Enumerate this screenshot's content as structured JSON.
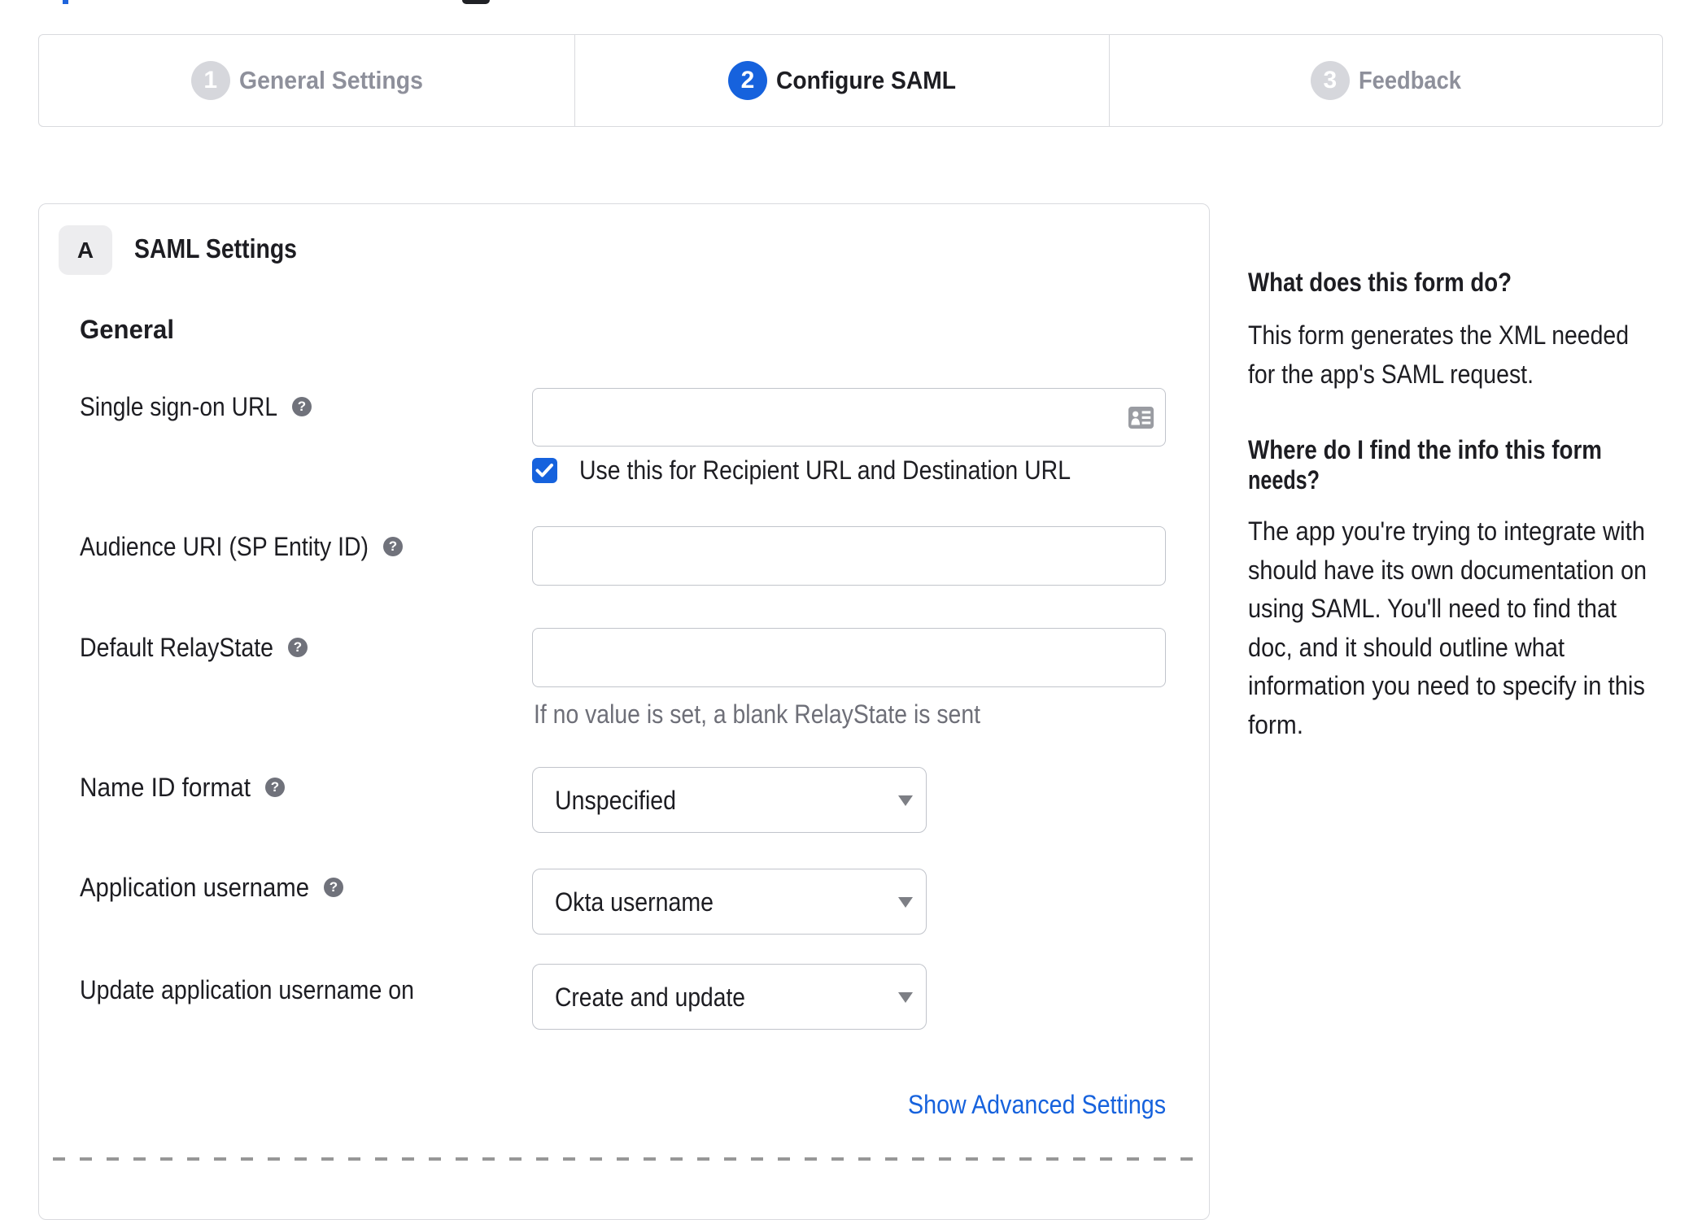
{
  "stepper": {
    "steps": [
      {
        "number": "1",
        "label": "General Settings",
        "state": "inactive"
      },
      {
        "number": "2",
        "label": "Configure SAML",
        "state": "active"
      },
      {
        "number": "3",
        "label": "Feedback",
        "state": "inactive"
      }
    ]
  },
  "panel": {
    "section_badge": "A",
    "section_title": "SAML Settings",
    "group_heading": "General",
    "show_advanced_label": "Show Advanced Settings"
  },
  "form": {
    "rows": [
      {
        "label": "Single sign-on URL",
        "has_help": true,
        "control": "input",
        "value": "",
        "checkbox_label": "Use this for Recipient URL and Destination URL",
        "checkbox_checked": true
      },
      {
        "label": "Audience URI (SP Entity ID)",
        "has_help": true,
        "control": "input",
        "value": ""
      },
      {
        "label": "Default RelayState",
        "has_help": true,
        "control": "input",
        "value": "",
        "helper": "If no value is set, a blank RelayState is sent"
      },
      {
        "label": "Name ID format",
        "has_help": true,
        "control": "select",
        "value": "Unspecified"
      },
      {
        "label": "Application username",
        "has_help": true,
        "control": "select",
        "value": "Okta username"
      },
      {
        "label": "Update application username on",
        "has_help": false,
        "control": "select",
        "value": "Create and update"
      }
    ]
  },
  "sidebar": {
    "what_heading": "What does this form do?",
    "what_body_lines": [
      "This form generates the XML needed",
      "for the app's SAML request."
    ],
    "where_heading_lines": [
      "Where do I find the info this form",
      "needs?"
    ],
    "where_body_lines": [
      "The app you're trying to integrate with",
      "should have its own documentation on",
      "using SAML. You'll need to find that",
      "doc, and it should outline what",
      "information you need to specify in this",
      "form."
    ]
  },
  "icons": {
    "help_glyph": "?",
    "help_icon": "question-mark-circle",
    "input_icon": "contact-card",
    "checkbox_icon": "checkmark",
    "select_icon": "caret-down"
  },
  "colors": {
    "accent_blue": "#1662dd",
    "inactive_step_gray": "#d6d7dc",
    "inactive_label_gray": "#8e909b",
    "text_dark": "#1d1d22",
    "muted_text": "#6e6f78",
    "border_gray": "#d9dade",
    "input_border": "#c1c4cb",
    "help_icon_gray": "#70727b"
  }
}
